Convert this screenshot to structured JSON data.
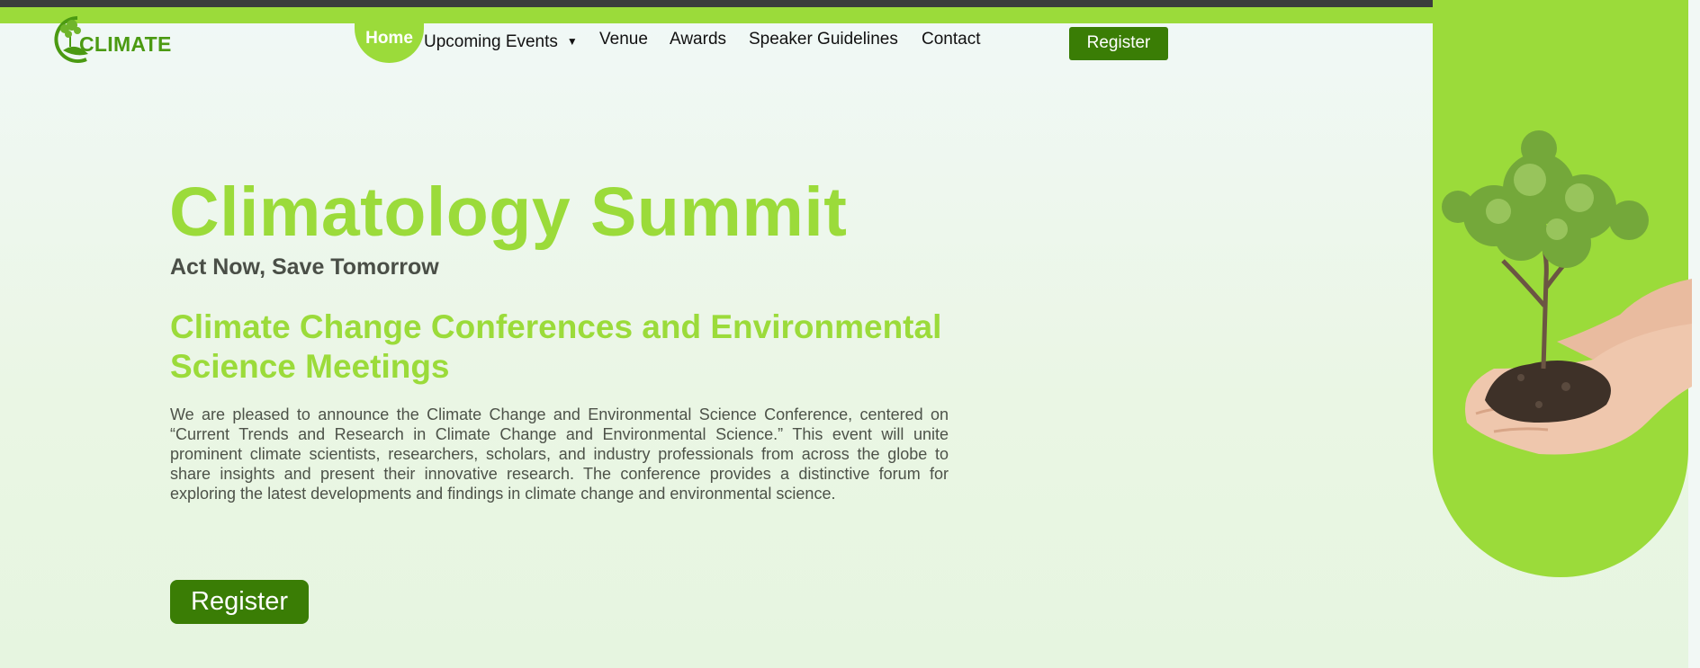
{
  "header": {
    "logo_text": "CLIMATE",
    "nav": {
      "home": "Home",
      "upcoming_events": "Upcoming Events",
      "venue": "Venue",
      "awards": "Awards",
      "speaker_guidelines": "Speaker Guidelines",
      "contact": "Contact"
    },
    "register_label": "Register"
  },
  "hero": {
    "title": "Climatology Summit",
    "tagline": "Act Now, Save Tomorrow",
    "subtitle": "Climate Change Conferences and Environmental Science Meetings",
    "description": "We are pleased to announce the Climate Change and Environmental Science Conference, centered on “Current Trends and Research in Climate Change and Environmental Science.” This event will unite prominent climate scientists, researchers, scholars, and industry professionals from across the globe to share insights and present their innovative research. The conference provides a distinctive forum for exploring the latest developments and findings in climate change and environmental science.",
    "register_label": "Register",
    "image_icon": "tree-in-hands-icon"
  },
  "colors": {
    "accent": "#9bdb3a",
    "button": "#3a7d05",
    "topbar": "#3b3d3c"
  }
}
